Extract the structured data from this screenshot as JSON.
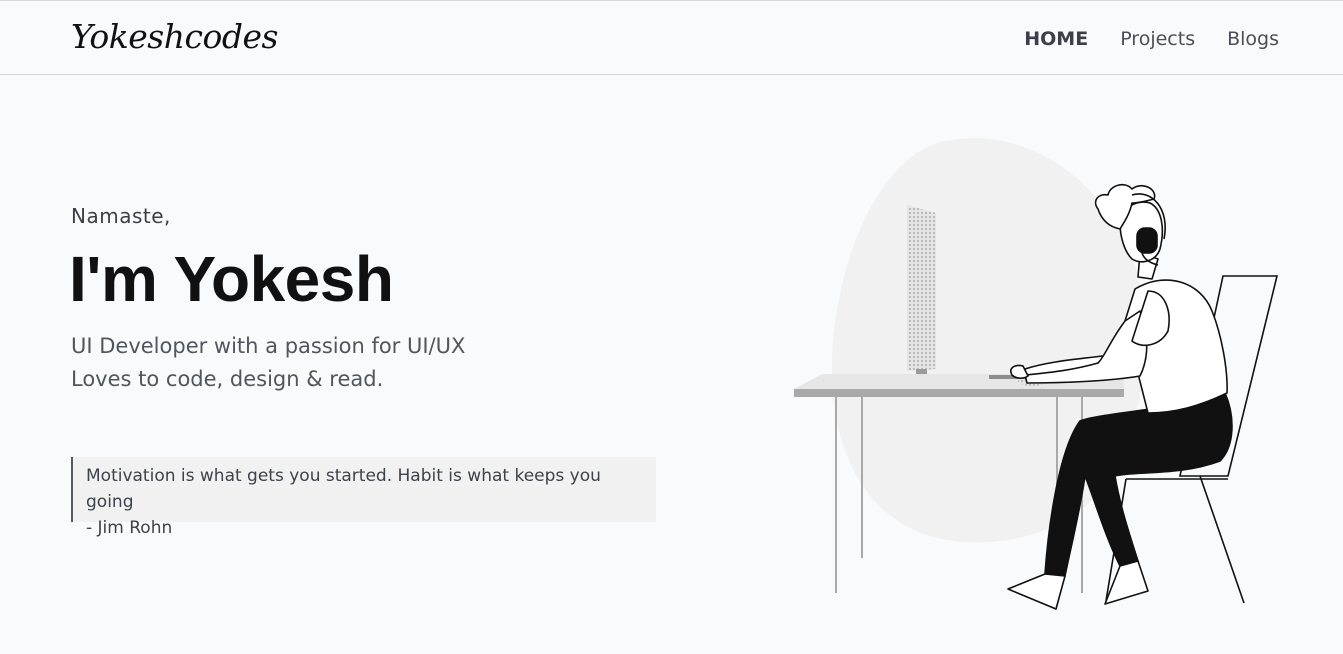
{
  "brand": {
    "logo_text": "Yokeshcodes"
  },
  "nav": {
    "items": [
      {
        "label": "HOME",
        "active": true
      },
      {
        "label": "Projects",
        "active": false
      },
      {
        "label": "Blogs",
        "active": false
      }
    ]
  },
  "hero": {
    "greeting": "Namaste,",
    "headline": "I'm Yokesh",
    "tagline_line1": "UI Developer with a passion for UI/UX",
    "tagline_line2": "Loves to code, design & read."
  },
  "quote": {
    "text": "Motivation is what gets you started. Habit is what keeps you going",
    "author": "- Jim Rohn"
  },
  "colors": {
    "background": "#f9fafb",
    "text_primary": "#111111",
    "text_secondary": "#50565e",
    "quote_bg": "#f1f1f1",
    "blob": "#f1f1f1"
  },
  "illustration": {
    "icon": "person-at-desk-illustration"
  }
}
